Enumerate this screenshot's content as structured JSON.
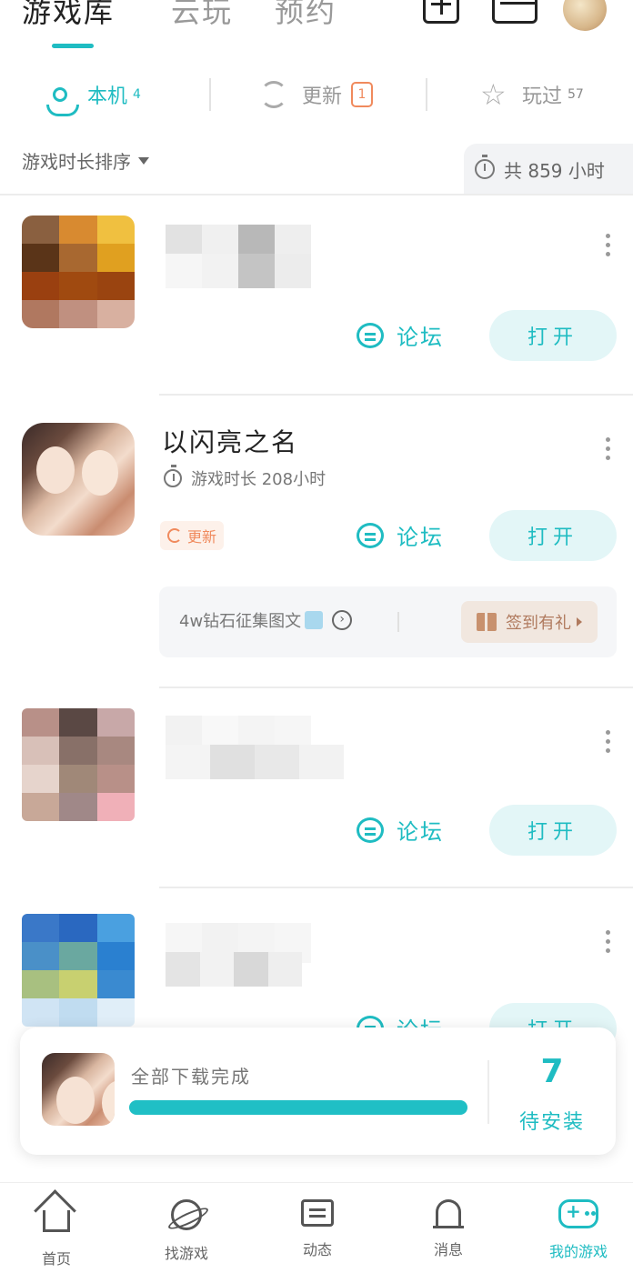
{
  "top_tabs": [
    {
      "label": "游戏库",
      "active": true
    },
    {
      "label": "云玩",
      "active": false
    },
    {
      "label": "预约",
      "active": false
    }
  ],
  "filters": {
    "local": {
      "label": "本机",
      "count": "4"
    },
    "update": {
      "label": "更新",
      "count": "1"
    },
    "played": {
      "label": "玩过",
      "count": "57"
    }
  },
  "sort": {
    "label": "游戏时长排序"
  },
  "total_time": {
    "label": "共 859 小时"
  },
  "games": [
    {
      "name": "",
      "blurred": true,
      "forum_label": "论坛",
      "open_label": "打开"
    },
    {
      "name": "以闪亮之名",
      "play_time": "游戏时长 208小时",
      "update_tag": "更新",
      "forum_label": "论坛",
      "open_label": "打开",
      "promo": {
        "text": "4w钻石征集图文",
        "checkin_label": "签到有礼"
      }
    },
    {
      "name": "",
      "blurred": true,
      "forum_label": "论坛",
      "open_label": "打开"
    },
    {
      "name": "",
      "blurred": true,
      "forum_label": "论坛",
      "open_label": "打开"
    }
  ],
  "download": {
    "status": "全部下载完成",
    "progress": 1.0,
    "pending_count": "7",
    "pending_label": "待安装"
  },
  "bottom_nav": [
    {
      "label": "首页",
      "icon": "home-icon"
    },
    {
      "label": "找游戏",
      "icon": "planet-icon"
    },
    {
      "label": "动态",
      "icon": "chat-icon"
    },
    {
      "label": "消息",
      "icon": "bell-icon"
    },
    {
      "label": "我的游戏",
      "icon": "gamepad-icon",
      "active": true
    }
  ],
  "colors": {
    "accent": "#1fbcc2",
    "update": "#f08a5d",
    "checkin": "#b07a5e"
  }
}
